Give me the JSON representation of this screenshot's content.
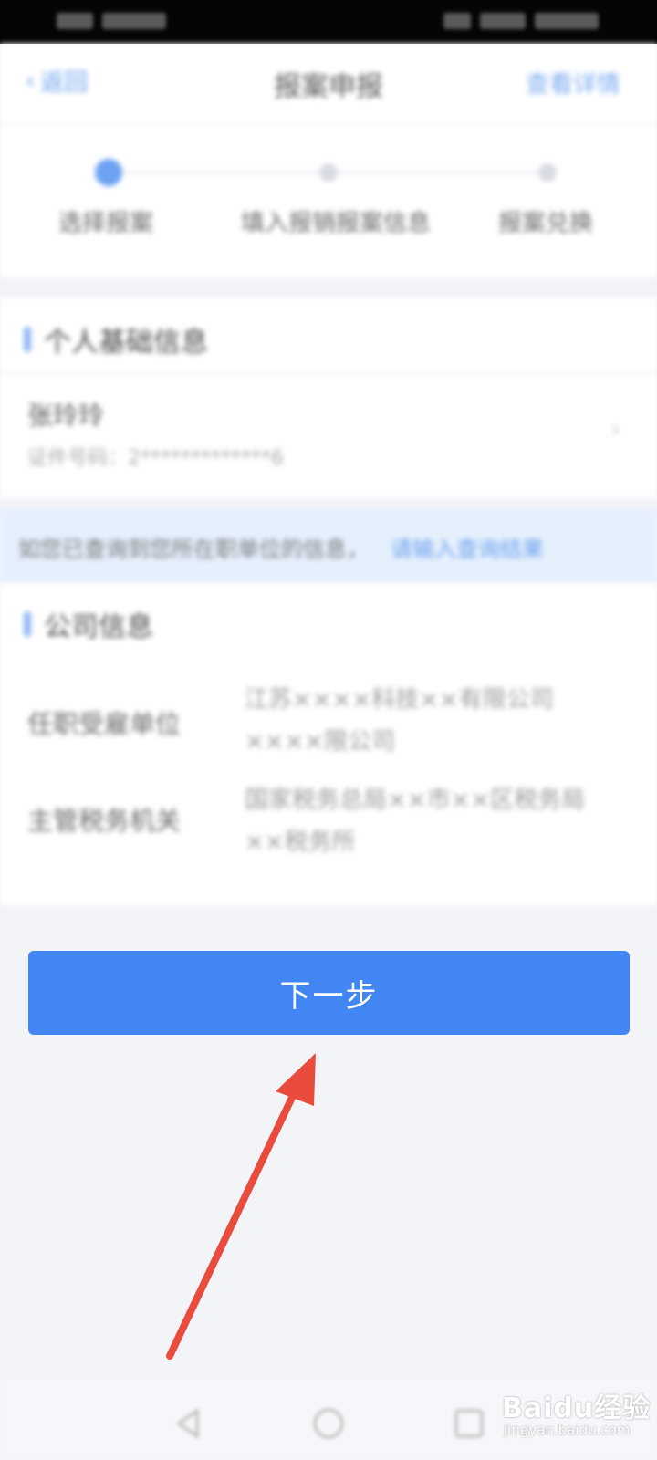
{
  "navbar": {
    "back_label": "返回",
    "title": "报案申报",
    "action_label": "查看详情"
  },
  "steps": [
    {
      "label": "选择报案",
      "state": "active"
    },
    {
      "label": "填入报销报案信息",
      "state": "idle"
    },
    {
      "label": "报案兑换",
      "state": "idle"
    }
  ],
  "personal_section": {
    "title": "个人基础信息",
    "name": "张玲玲",
    "id_line": "证件号码：2*************6"
  },
  "notice": {
    "text": "如您已查询到您所在职单位的信息，",
    "link": "请输入查询结果"
  },
  "company_section": {
    "title": "公司信息",
    "fields": [
      {
        "label": "任职受雇单位",
        "value": "江苏××××科技××有限公司××××限公司"
      },
      {
        "label": "主管税务机关",
        "value": "国家税务总局××市××区税务局××税务所"
      }
    ]
  },
  "next_button": {
    "label": "下一步"
  },
  "watermark": {
    "main": "Baidu经验",
    "sub": "jingyan.baidu.com"
  },
  "colors": {
    "accent": "#4286f4",
    "annotation_arrow": "#e94b3c",
    "notice_bg": "#e6f0fd"
  }
}
